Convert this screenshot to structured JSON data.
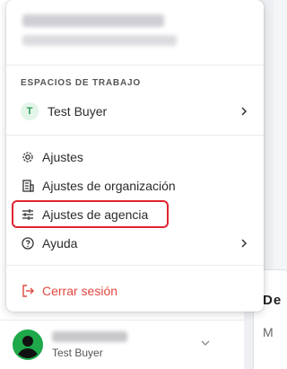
{
  "menu": {
    "section_label": "ESPACIOS DE TRABAJO",
    "workspace": {
      "initial": "T",
      "name": "Test Buyer"
    },
    "items": [
      {
        "label": "Ajustes",
        "icon": "gear-icon"
      },
      {
        "label": "Ajustes de organización",
        "icon": "building-icon"
      },
      {
        "label": "Ajustes de agencia",
        "icon": "sliders-icon",
        "highlighted": true
      },
      {
        "label": "Ayuda",
        "icon": "help-circle-icon"
      }
    ],
    "logout_label": "Cerrar sesión"
  },
  "user_bar": {
    "role": "Test Buyer"
  },
  "background": {
    "panel_heading": "De",
    "panel_text": "M"
  },
  "colors": {
    "accent_red": "#e0232e",
    "logout_red": "#e0483f",
    "avatar_green": "#1ea84a",
    "badge_bg": "#e3f4e8",
    "badge_text": "#2f9a55"
  }
}
